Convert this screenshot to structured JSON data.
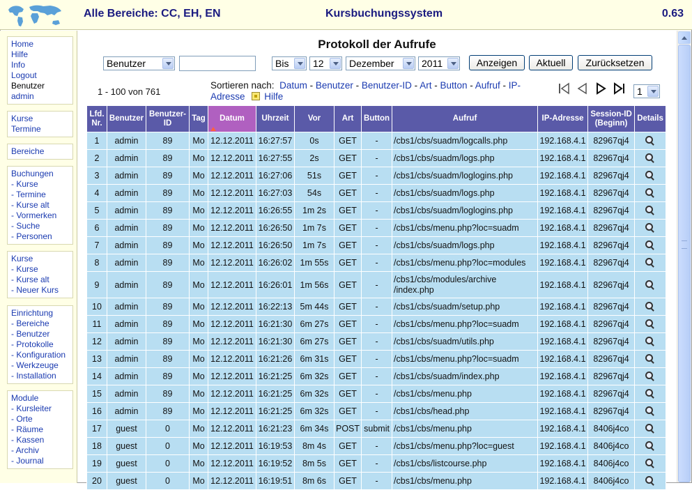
{
  "header": {
    "area_title": "Alle Bereiche: CC, EH, EN",
    "app_title": "Kursbuchungssystem",
    "version": "0.63"
  },
  "sidebar": {
    "groups": [
      [
        "Home",
        "Hilfe",
        "Info",
        "Logout",
        "Benutzer",
        "admin"
      ],
      [
        "Kurse",
        "Termine"
      ],
      [
        "Bereiche"
      ],
      [
        "Buchungen",
        "- Kurse",
        "- Termine",
        "- Kurse alt",
        "- Vormerken",
        "- Suche",
        "- Personen"
      ],
      [
        "Kurse",
        "- Kurse",
        "- Kurse alt",
        "- Neuer Kurs"
      ],
      [
        "Einrichtung",
        "- Bereiche",
        "- Benutzer",
        "- Protokolle",
        "- Konfiguration",
        "- Werkzeuge",
        "- Installation"
      ],
      [
        "Module",
        "- Kursleiter",
        "- Orte",
        "- Räume",
        "- Kassen",
        "- Archiv",
        "- Journal"
      ]
    ]
  },
  "main": {
    "title": "Protokoll der Aufrufe",
    "filters": {
      "field": "Benutzer",
      "search_value": "",
      "range": "Bis",
      "day": "12",
      "month": "Dezember",
      "year": "2011"
    },
    "buttons": {
      "show": "Anzeigen",
      "current": "Aktuell",
      "reset": "Zurücksetzen"
    },
    "count": "1 - 100 von 761",
    "sort": {
      "label": "Sortieren nach:",
      "links": [
        "Datum",
        "Benutzer",
        "Benutzer-ID",
        "Art",
        "Button",
        "Aufruf",
        "IP-Adresse"
      ],
      "help": "Hilfe"
    },
    "page_select": "1",
    "columns": [
      "Lfd. Nr.",
      "Benutzer",
      "Benutzer-ID",
      "Tag",
      "Datum",
      "Uhrzeit",
      "Vor",
      "Art",
      "Button",
      "Aufruf",
      "IP-Adresse",
      "Session-ID (Beginn)",
      "Details"
    ],
    "rows": [
      [
        "1",
        "admin",
        "89",
        "Mo",
        "12.12.2011",
        "16:27:57",
        "0s",
        "GET",
        "-",
        "/cbs1/cbs/suadm/logcalls.php",
        "192.168.4.1",
        "82967qj4"
      ],
      [
        "2",
        "admin",
        "89",
        "Mo",
        "12.12.2011",
        "16:27:55",
        "2s",
        "GET",
        "-",
        "/cbs1/cbs/suadm/logs.php",
        "192.168.4.1",
        "82967qj4"
      ],
      [
        "3",
        "admin",
        "89",
        "Mo",
        "12.12.2011",
        "16:27:06",
        "51s",
        "GET",
        "-",
        "/cbs1/cbs/suadm/loglogins.php",
        "192.168.4.1",
        "82967qj4"
      ],
      [
        "4",
        "admin",
        "89",
        "Mo",
        "12.12.2011",
        "16:27:03",
        "54s",
        "GET",
        "-",
        "/cbs1/cbs/suadm/logs.php",
        "192.168.4.1",
        "82967qj4"
      ],
      [
        "5",
        "admin",
        "89",
        "Mo",
        "12.12.2011",
        "16:26:55",
        "1m 2s",
        "GET",
        "-",
        "/cbs1/cbs/suadm/loglogins.php",
        "192.168.4.1",
        "82967qj4"
      ],
      [
        "6",
        "admin",
        "89",
        "Mo",
        "12.12.2011",
        "16:26:50",
        "1m 7s",
        "GET",
        "-",
        "/cbs1/cbs/menu.php?loc=suadm",
        "192.168.4.1",
        "82967qj4"
      ],
      [
        "7",
        "admin",
        "89",
        "Mo",
        "12.12.2011",
        "16:26:50",
        "1m 7s",
        "GET",
        "-",
        "/cbs1/cbs/suadm/logs.php",
        "192.168.4.1",
        "82967qj4"
      ],
      [
        "8",
        "admin",
        "89",
        "Mo",
        "12.12.2011",
        "16:26:02",
        "1m 55s",
        "GET",
        "-",
        "/cbs1/cbs/menu.php?loc=modules",
        "192.168.4.1",
        "82967qj4"
      ],
      [
        "9",
        "admin",
        "89",
        "Mo",
        "12.12.2011",
        "16:26:01",
        "1m 56s",
        "GET",
        "-",
        "/cbs1/cbs/modules/archive /index.php",
        "192.168.4.1",
        "82967qj4"
      ],
      [
        "10",
        "admin",
        "89",
        "Mo",
        "12.12.2011",
        "16:22:13",
        "5m 44s",
        "GET",
        "-",
        "/cbs1/cbs/suadm/setup.php",
        "192.168.4.1",
        "82967qj4"
      ],
      [
        "11",
        "admin",
        "89",
        "Mo",
        "12.12.2011",
        "16:21:30",
        "6m 27s",
        "GET",
        "-",
        "/cbs1/cbs/menu.php?loc=suadm",
        "192.168.4.1",
        "82967qj4"
      ],
      [
        "12",
        "admin",
        "89",
        "Mo",
        "12.12.2011",
        "16:21:30",
        "6m 27s",
        "GET",
        "-",
        "/cbs1/cbs/suadm/utils.php",
        "192.168.4.1",
        "82967qj4"
      ],
      [
        "13",
        "admin",
        "89",
        "Mo",
        "12.12.2011",
        "16:21:26",
        "6m 31s",
        "GET",
        "-",
        "/cbs1/cbs/menu.php?loc=suadm",
        "192.168.4.1",
        "82967qj4"
      ],
      [
        "14",
        "admin",
        "89",
        "Mo",
        "12.12.2011",
        "16:21:25",
        "6m 32s",
        "GET",
        "-",
        "/cbs1/cbs/suadm/index.php",
        "192.168.4.1",
        "82967qj4"
      ],
      [
        "15",
        "admin",
        "89",
        "Mo",
        "12.12.2011",
        "16:21:25",
        "6m 32s",
        "GET",
        "-",
        "/cbs1/cbs/menu.php",
        "192.168.4.1",
        "82967qj4"
      ],
      [
        "16",
        "admin",
        "89",
        "Mo",
        "12.12.2011",
        "16:21:25",
        "6m 32s",
        "GET",
        "-",
        "/cbs1/cbs/head.php",
        "192.168.4.1",
        "82967qj4"
      ],
      [
        "17",
        "guest",
        "0",
        "Mo",
        "12.12.2011",
        "16:21:23",
        "6m 34s",
        "POST",
        "submit",
        "/cbs1/cbs/menu.php",
        "192.168.4.1",
        "8406j4co"
      ],
      [
        "18",
        "guest",
        "0",
        "Mo",
        "12.12.2011",
        "16:19:53",
        "8m 4s",
        "GET",
        "-",
        "/cbs1/cbs/menu.php?loc=guest",
        "192.168.4.1",
        "8406j4co"
      ],
      [
        "19",
        "guest",
        "0",
        "Mo",
        "12.12.2011",
        "16:19:52",
        "8m 5s",
        "GET",
        "-",
        "/cbs1/cbs/listcourse.php",
        "192.168.4.1",
        "8406j4co"
      ],
      [
        "20",
        "guest",
        "0",
        "Mo",
        "12.12.2011",
        "16:19:51",
        "8m 6s",
        "GET",
        "-",
        "/cbs1/cbs/menu.php",
        "192.168.4.1",
        "8406j4co"
      ]
    ]
  },
  "icons": {
    "logo": "world-map-icon",
    "details": "magnifier-icon",
    "first": "first-page-icon",
    "prev": "prev-page-icon",
    "next": "next-page-icon",
    "last": "last-page-icon"
  },
  "colors": {
    "header_bg": "#5a5aa8",
    "sorted_header_bg": "#b060c0",
    "row_bg": "#b8def2",
    "sidebar_bg": "#ffffe6",
    "link": "#1a3ab0",
    "title": "#1a1a80"
  }
}
